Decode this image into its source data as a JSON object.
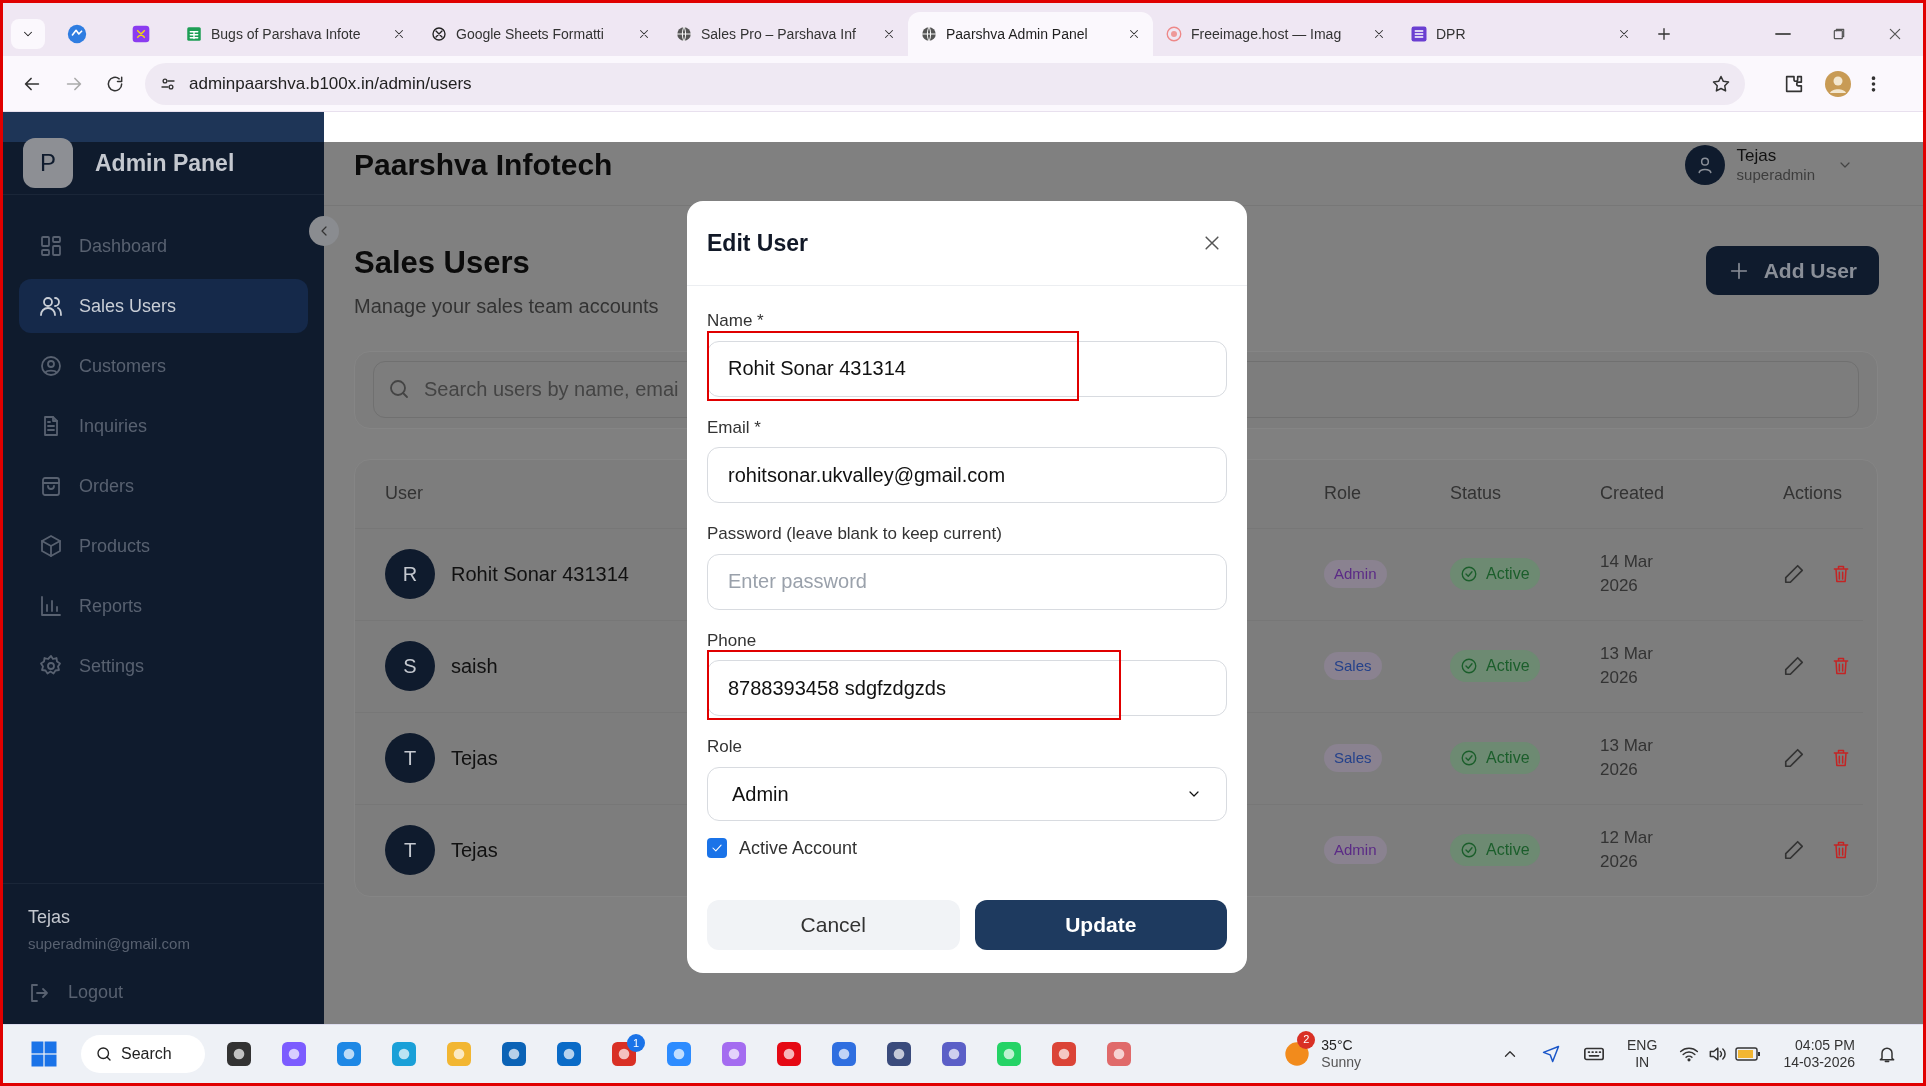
{
  "browser": {
    "tabs": [
      {
        "title": "Bugs of Parshava Infote",
        "selected": false
      },
      {
        "title": "Google Sheets Formatti",
        "selected": false
      },
      {
        "title": "Sales Pro – Parshava Inf",
        "selected": false
      },
      {
        "title": "Paarshva Admin Panel",
        "selected": true
      },
      {
        "title": "Freeimage.host — Imag",
        "selected": false
      },
      {
        "title": "DPR",
        "selected": false
      }
    ],
    "url": "adminpaarshva.b100x.in/admin/users"
  },
  "sidebar": {
    "logo_letter": "P",
    "title": "Admin Panel",
    "items": [
      {
        "label": "Dashboard",
        "selected": false
      },
      {
        "label": "Sales Users",
        "selected": true
      },
      {
        "label": "Customers",
        "selected": false
      },
      {
        "label": "Inquiries",
        "selected": false
      },
      {
        "label": "Orders",
        "selected": false
      },
      {
        "label": "Products",
        "selected": false
      },
      {
        "label": "Reports",
        "selected": false
      },
      {
        "label": "Settings",
        "selected": false
      }
    ],
    "user_name": "Tejas",
    "user_email": "superadmin@gmail.com",
    "logout": "Logout"
  },
  "header": {
    "company": "Paarshva Infotech",
    "user_name": "Tejas",
    "user_role": "superadmin"
  },
  "page": {
    "title": "Sales Users",
    "subtitle": "Manage your sales team accounts",
    "add_button": "Add User",
    "search_placeholder": "Search users by name, emai"
  },
  "table": {
    "columns": [
      "User",
      "Role",
      "Status",
      "Created",
      "Actions"
    ],
    "rows": [
      {
        "initial": "R",
        "name": "Rohit Sonar 431314",
        "role": {
          "label": "Admin",
          "color": "#5b2a86"
        },
        "status": "Active",
        "created": "14 Mar 2026"
      },
      {
        "initial": "S",
        "name": "saish",
        "role": {
          "label": "Sales",
          "color": "#24418a"
        },
        "status": "Active",
        "created": "13 Mar 2026"
      },
      {
        "initial": "T",
        "name": "Tejas",
        "role": {
          "label": "Sales",
          "color": "#24418a"
        },
        "status": "Active",
        "created": "13 Mar 2026"
      },
      {
        "initial": "T",
        "name": "Tejas",
        "role": {
          "label": "Admin",
          "color": "#5b2a86"
        },
        "status": "Active",
        "created": "12 Mar 2026"
      }
    ]
  },
  "modal": {
    "title": "Edit User",
    "fields": [
      {
        "kind": "text",
        "label": "Name *",
        "value": "Rohit Sonar 431314",
        "marked": true
      },
      {
        "kind": "text",
        "label": "Email *",
        "value": "rohitsonar.ukvalley@gmail.com",
        "marked": false
      },
      {
        "kind": "text",
        "label": "Password (leave blank to keep current)",
        "placeholder": "Enter password",
        "marked": false
      },
      {
        "kind": "text",
        "label": "Phone",
        "value": "8788393458 sdgfzdgzds",
        "marked": true
      },
      {
        "kind": "select",
        "label": "Role",
        "value": "Admin",
        "marked": false
      }
    ],
    "checkbox": {
      "label": "Active Account",
      "checked": true
    },
    "cancel": "Cancel",
    "submit": "Update"
  },
  "taskbar": {
    "search": "Search",
    "app_badge": "1",
    "weather_badge": "2",
    "temperature": "35°C",
    "condition": "Sunny",
    "lang": "ENG",
    "region": "IN",
    "time": "04:05 PM",
    "date": "14-03-2026"
  }
}
